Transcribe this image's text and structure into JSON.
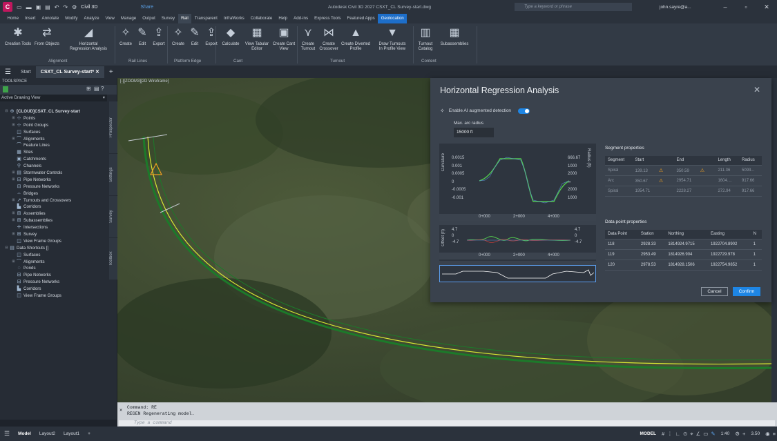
{
  "window": {
    "app_badge": "C",
    "workspace": "Civil 3D",
    "share": "Share",
    "title": "Autodesk Civil 3D 2027   CSXT_CL Survey-start.dwg",
    "search_placeholder": "Type a keyword or phrase",
    "user": "john.sayre@a..."
  },
  "menu_tabs": [
    "Home",
    "Insert",
    "Annotate",
    "Modify",
    "Analyze",
    "View",
    "Manage",
    "Output",
    "Survey",
    "Rail",
    "Transparent",
    "InfraWorks",
    "Collaborate",
    "Help",
    "Add-ins",
    "Express Tools",
    "Featured Apps",
    "Geolocation"
  ],
  "ribbon": {
    "buttons": [
      {
        "l1": "Creation Tools",
        "l2": "",
        "icon": "creation-tools"
      },
      {
        "l1": "From Objects",
        "l2": "",
        "icon": "from-objects"
      },
      {
        "l1": "Horizontal",
        "l2": "Regression Analysis",
        "icon": "regression"
      },
      {
        "l1": "Create",
        "l2": "",
        "icon": "rail-create"
      },
      {
        "l1": "Edit",
        "l2": "",
        "icon": "rail-edit"
      },
      {
        "l1": "Export",
        "l2": "",
        "icon": "rail-export"
      },
      {
        "l1": "Create",
        "l2": "",
        "icon": "platform-create"
      },
      {
        "l1": "Edit",
        "l2": "",
        "icon": "platform-edit"
      },
      {
        "l1": "Export",
        "l2": "",
        "icon": "platform-export"
      },
      {
        "l1": "Calculate",
        "l2": "",
        "icon": "cant-calculate"
      },
      {
        "l1": "View Tabular",
        "l2": "Editor",
        "icon": "tabular-editor"
      },
      {
        "l1": "Create Cant",
        "l2": "View",
        "icon": "cant-view"
      },
      {
        "l1": "Create",
        "l2": "Turnout",
        "icon": "turnout"
      },
      {
        "l1": "Create",
        "l2": "Crossover",
        "icon": "crossover"
      },
      {
        "l1": "Create Diverted",
        "l2": "Profile",
        "icon": "diverted-profile"
      },
      {
        "l1": "Draw Turnouts",
        "l2": "In Profile View",
        "icon": "draw-turnouts"
      },
      {
        "l1": "Turnout",
        "l2": "Catalog",
        "icon": "turnout-catalog"
      },
      {
        "l1": "Subassemblies",
        "l2": "",
        "icon": "subassemblies"
      }
    ],
    "groups": [
      "Alignment",
      "Rail Lines",
      "Platform Edge",
      "Cant",
      "Turnout",
      "Content"
    ]
  },
  "doc_tabs": {
    "start": "Start",
    "active": "CSXT_CL Survey-start*"
  },
  "toolspace": {
    "header": "TOOLSPACE",
    "view": "Active Drawing View",
    "tree": [
      {
        "label": "[CLOUD]CSXT_CL Survey-start",
        "indent": 0,
        "exp": "⊟",
        "bold": true
      },
      {
        "label": "Points",
        "indent": 1,
        "exp": "⊞"
      },
      {
        "label": "Point Groups",
        "indent": 1,
        "exp": "⊞"
      },
      {
        "label": "Surfaces",
        "indent": 1,
        "exp": ""
      },
      {
        "label": "Alignments",
        "indent": 1,
        "exp": "⊞"
      },
      {
        "label": "Feature Lines",
        "indent": 1,
        "exp": ""
      },
      {
        "label": "Sites",
        "indent": 1,
        "exp": ""
      },
      {
        "label": "Catchments",
        "indent": 1,
        "exp": ""
      },
      {
        "label": "Channels",
        "indent": 1,
        "exp": ""
      },
      {
        "label": "Stormwater Controls",
        "indent": 1,
        "exp": "⊞"
      },
      {
        "label": "Pipe Networks",
        "indent": 1,
        "exp": "⊞"
      },
      {
        "label": "Pressure Networks",
        "indent": 1,
        "exp": ""
      },
      {
        "label": "Bridges",
        "indent": 1,
        "exp": ""
      },
      {
        "label": "Turnouts and Crossovers",
        "indent": 1,
        "exp": "⊞"
      },
      {
        "label": "Corridors",
        "indent": 1,
        "exp": ""
      },
      {
        "label": "Assemblies",
        "indent": 1,
        "exp": "⊞"
      },
      {
        "label": "Subassemblies",
        "indent": 1,
        "exp": "⊞"
      },
      {
        "label": "Intersections",
        "indent": 1,
        "exp": ""
      },
      {
        "label": "Survey",
        "indent": 1,
        "exp": "⊞"
      },
      {
        "label": "View Frame Groups",
        "indent": 1,
        "exp": ""
      },
      {
        "label": "Data Shortcuts []",
        "indent": 0,
        "exp": "⊟"
      },
      {
        "label": "Surfaces",
        "indent": 1,
        "exp": ""
      },
      {
        "label": "Alignments",
        "indent": 1,
        "exp": "⊞"
      },
      {
        "label": "Ponds",
        "indent": 1,
        "exp": ""
      },
      {
        "label": "Pipe Networks",
        "indent": 1,
        "exp": ""
      },
      {
        "label": "Pressure Networks",
        "indent": 1,
        "exp": ""
      },
      {
        "label": "Corridors",
        "indent": 1,
        "exp": ""
      },
      {
        "label": "View Frame Groups",
        "indent": 1,
        "exp": ""
      }
    ],
    "side_tabs": [
      "Prospector",
      "Settings",
      "Survey",
      "Toolbox"
    ]
  },
  "viewport": {
    "label": "[-][ZOOM3][2D Wireframe]"
  },
  "dialog": {
    "title": "Horizontal Regression Analysis",
    "ai_label": "Enable AI augmented detection",
    "ai_on": true,
    "max_arc_label": "Max. arc radius",
    "max_arc_value": "15000 ft",
    "curv_chart": {
      "ylabel_left": "Curvature",
      "ylabel_right": "Radius (ft)",
      "left_ticks": [
        "0.0015",
        "0.001",
        "0.0005",
        "0",
        "-0.0005",
        "-0.001"
      ],
      "right_ticks": [
        "666.67",
        "1000",
        "2000",
        "∞",
        "2000",
        "1000"
      ],
      "x_ticks": [
        "0+000",
        "2+000",
        "4+000"
      ]
    },
    "offset_chart": {
      "ylabel": "Offset (ft)",
      "left_ticks": [
        "4.7",
        "0",
        "-4.7"
      ],
      "right_ticks": [
        "4.7",
        "0",
        "-4.7"
      ],
      "x_ticks": [
        "0+000",
        "2+000",
        "4+000"
      ]
    },
    "segment_title": "Segment properties",
    "segment_cols": [
      "Segment",
      "Start",
      "End",
      "Length",
      "Radius"
    ],
    "segments": [
      {
        "seg": "Spiral",
        "start": "139.13",
        "start_warn": true,
        "end": "350.59",
        "end_warn": true,
        "length": "211.36",
        "radius": "5093..."
      },
      {
        "seg": "Arc",
        "start": "350.67",
        "start_warn": true,
        "end": "2954.71",
        "end_warn": false,
        "length": "1604....",
        "radius": "917.66"
      },
      {
        "seg": "Spiral",
        "start": "1954.71",
        "start_warn": false,
        "end": "2228.27",
        "end_warn": false,
        "length": "272.94",
        "radius": "917.66"
      }
    ],
    "point_title": "Data point properties",
    "point_cols": [
      "Data Point",
      "Station",
      "Northing",
      "Easting",
      "N"
    ],
    "points": [
      {
        "pt": "118",
        "station": "2928.33",
        "north": "1814924.9715",
        "east": "1922704.8902",
        "n": "1"
      },
      {
        "pt": "119",
        "station": "2953.49",
        "north": "1814926.904",
        "east": "1922729.978",
        "n": "1"
      },
      {
        "pt": "120",
        "station": "2978.53",
        "north": "1814928.1506",
        "east": "1922754.9852",
        "n": "1"
      }
    ],
    "cancel": "Cancel",
    "confirm": "Confirm"
  },
  "command": {
    "line1": "Command: RE",
    "line2": "REGEN Regenerating model.",
    "placeholder": "Type a command"
  },
  "status": {
    "model": "Model",
    "layout1": "Layout1",
    "layout2": "Layout2",
    "model_right": "MODEL",
    "scale": "1:40",
    "value": "3.50"
  }
}
